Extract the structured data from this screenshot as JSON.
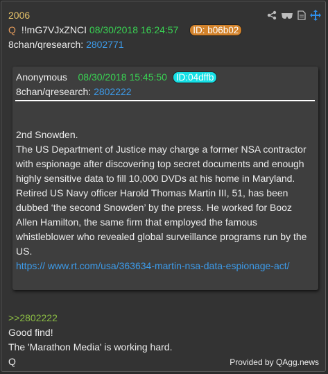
{
  "post": {
    "number": "2006",
    "q_label": "Q",
    "tripcode": "!!mG7VJxZNCI",
    "timestamp": "08/30/2018 16:24:57",
    "id_label": "ID: b06b02",
    "board": "8chan/qresearch:",
    "post_link": "2802771"
  },
  "icons": [
    "share-icon",
    "glasses-icon",
    "document-icon",
    "move-icon"
  ],
  "quoted": {
    "author": "Anonymous",
    "timestamp": "08/30/2018 15:45:50",
    "id_label": "ID:04dffb",
    "board": "8chan/qresearch:",
    "post_link": "2802222",
    "body": "2nd Snowden.\nThe US Department of Justice may charge a former NSA contractor with espionage after discovering top secret documents and enough highly sensitive data to fill 10,000 DVDs at his home in Maryland. Retired US Navy officer Harold Thomas Martin III, 51, has been dubbed ‘the second Snowden’ by the press. He worked for Booz Allen Hamilton, the same firm that employed the famous whistleblower who revealed global surveillance programs run by the US.",
    "url": "https:// www.rt.com/usa/363634-martin-nsa-data-espionage-act/"
  },
  "reply": {
    "ref": ">>2802222",
    "line1": "Good find!",
    "line2": "The 'Marathon Media' is working hard.",
    "line3": "Q"
  },
  "footer": "Provided by QAgg.news"
}
